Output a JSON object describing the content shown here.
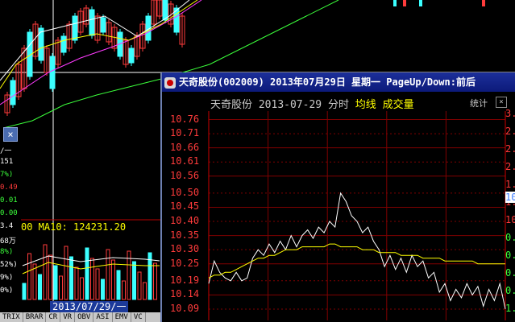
{
  "background": {
    "left_axis_values": [
      "/一",
      "151",
      "7%)",
      "0.49",
      "0.01",
      "0.00",
      "3.4",
      "68万",
      "8%)",
      "52%)",
      "9%)",
      "0%)"
    ],
    "ma_label": "00  MA10: 124231.20",
    "date_tag": "2013/07/29/一",
    "bottom_tabs": [
      "TRIX",
      "BRAR",
      "CR",
      "VR",
      "OBV",
      "ASI",
      "EMV",
      "VC"
    ]
  },
  "popup": {
    "title": "天奇股份(002009) 2013年07月29日 星期一 PageUp/Down:前后",
    "header": {
      "name": "天奇股份",
      "date": "2013-07-29",
      "mode": "分时",
      "avg_label": "均线",
      "vol_label": "成交量",
      "stat_label": "统计"
    },
    "y_labels": [
      "10.76",
      "10.71",
      "10.66",
      "10.61",
      "10.56",
      "10.50",
      "10.45",
      "10.40",
      "10.35",
      "10.30",
      "10.25",
      "10.19",
      "10.14",
      "10.09"
    ],
    "right_labels": [
      "3.",
      "2.",
      "2.",
      "2.",
      "1.",
      "1.",
      "10",
      "0.",
      "0.",
      "0.",
      "0.",
      "1."
    ],
    "right_highlight": "10"
  },
  "chart_data": {
    "type": "line",
    "title": "",
    "xlabel": "",
    "ylabel": "",
    "ylim": [
      10.05,
      10.79
    ],
    "series": [
      {
        "name": "",
        "values": [
          10.18,
          10.26,
          10.22,
          10.2,
          10.19,
          10.22,
          10.19,
          10.2,
          10.27,
          10.3,
          10.28,
          10.32,
          10.29,
          10.33,
          10.3,
          10.35,
          10.31,
          10.35,
          10.37,
          10.34,
          10.38,
          10.36,
          10.4,
          10.38,
          10.5,
          10.47,
          10.42,
          10.4,
          10.36,
          10.38,
          10.33,
          10.3,
          10.24,
          10.28,
          10.23,
          10.27,
          10.22,
          10.28,
          10.24,
          10.26,
          10.2,
          10.22,
          10.15,
          10.18,
          10.12,
          10.16,
          10.13,
          10.18,
          10.14,
          10.17,
          10.1,
          10.16,
          10.12,
          10.18,
          10.09
        ]
      },
      {
        "name": "均线",
        "values": [
          10.2,
          10.21,
          10.21,
          10.22,
          10.22,
          10.23,
          10.24,
          10.25,
          10.26,
          10.27,
          10.27,
          10.28,
          10.28,
          10.29,
          10.3,
          10.3,
          10.3,
          10.31,
          10.31,
          10.31,
          10.31,
          10.31,
          10.32,
          10.32,
          10.31,
          10.31,
          10.31,
          10.31,
          10.3,
          10.3,
          10.3,
          10.29,
          10.29,
          10.29,
          10.29,
          10.28,
          10.28,
          10.28,
          10.28,
          10.27,
          10.27,
          10.27,
          10.27,
          10.26,
          10.26,
          10.26,
          10.26,
          10.26,
          10.26,
          10.25,
          10.25,
          10.25,
          10.25,
          10.25,
          10.25
        ]
      }
    ]
  }
}
